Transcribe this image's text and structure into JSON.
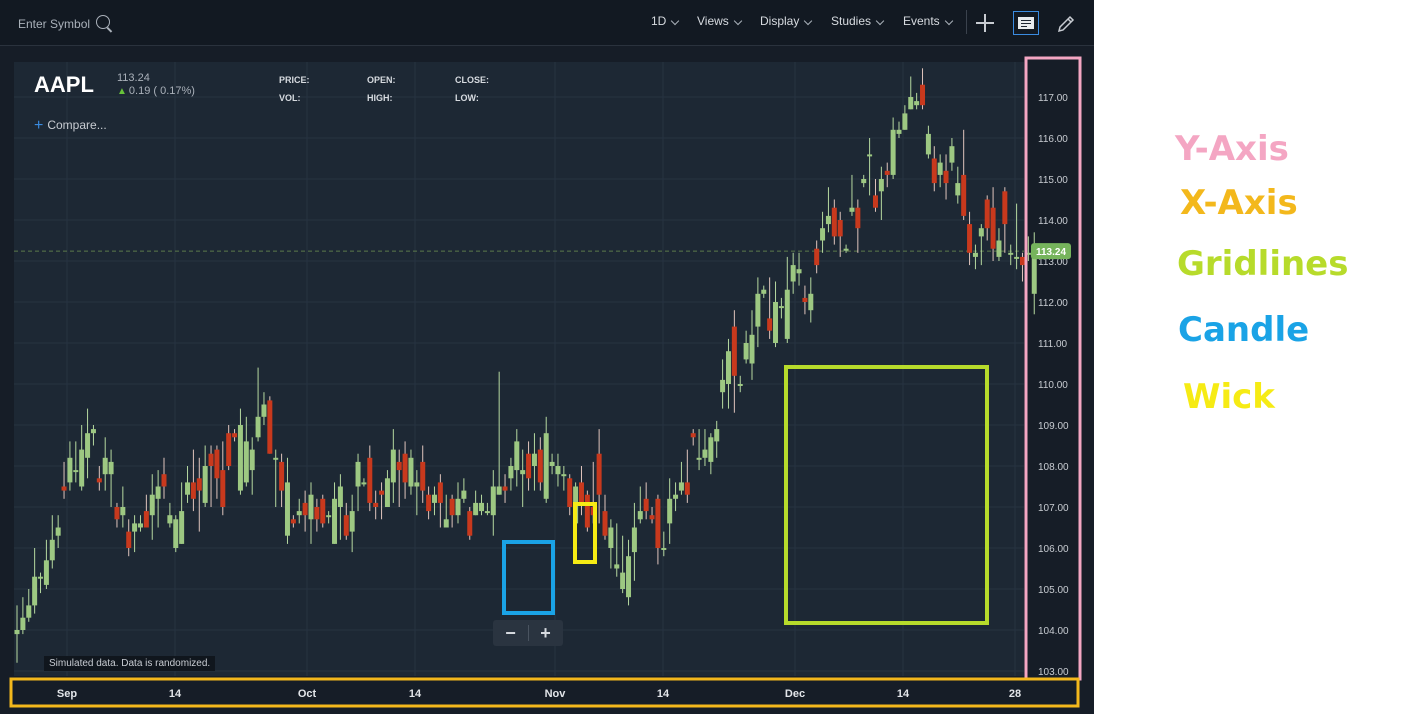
{
  "toolbar": {
    "search_placeholder": "Enter Symbol",
    "interval": "1D",
    "menus": [
      "Views",
      "Display",
      "Studies",
      "Events"
    ]
  },
  "quote": {
    "symbol": "AAPL",
    "price": "113.24",
    "change": "0.19 ( 0.17%)",
    "change_direction": "up",
    "labels": {
      "price": "PRICE:",
      "vol": "VOL:",
      "open": "OPEN:",
      "high": "HIGH:",
      "close": "CLOSE:",
      "low": "LOW:"
    }
  },
  "compare_label": "Compare...",
  "disclaimer": "Simulated data. Data is randomized.",
  "zoom": {
    "minus": "−",
    "plus": "+"
  },
  "colors": {
    "up": "#9dc882",
    "down": "#c8391d",
    "last_price": "#76b45c",
    "y_axis_box": "#f4a6c3",
    "x_axis_box": "#f3b81c",
    "gridlines_box": "#b7db2b",
    "candle_box": "#1aa3e6",
    "wick_box": "#f6eb14"
  },
  "annotations": [
    {
      "key": "y_axis",
      "label": "Y-Axis",
      "color": "#f4a6c3"
    },
    {
      "key": "x_axis",
      "label": "X-Axis",
      "color": "#f3b81c"
    },
    {
      "key": "gridlines",
      "label": "Gridlines",
      "color": "#b7db2b"
    },
    {
      "key": "candle",
      "label": "Candle",
      "color": "#1aa3e6"
    },
    {
      "key": "wick",
      "label": "Wick",
      "color": "#f6eb14"
    }
  ],
  "chart_data": {
    "type": "candlestick",
    "symbol": "AAPL",
    "y_tick_labels": [
      "103.00",
      "104.00",
      "105.00",
      "106.00",
      "107.00",
      "108.00",
      "109.00",
      "110.00",
      "111.00",
      "112.00",
      "113.00",
      "114.00",
      "115.00",
      "116.00",
      "117.00"
    ],
    "x_tick_labels": [
      "Sep",
      "14",
      "Oct",
      "14",
      "Nov",
      "14",
      "Dec",
      "14",
      "28"
    ],
    "ylim": [
      103.0,
      117.65
    ],
    "last_price": 113.24,
    "last_price_label": "113.24",
    "grid": true,
    "candles": [
      [
        103.9,
        104.0,
        104.6,
        103.2
      ],
      [
        104.0,
        104.3,
        104.8,
        103.9
      ],
      [
        104.3,
        104.6,
        105.0,
        104.2
      ],
      [
        104.6,
        105.3,
        106.0,
        104.4
      ],
      [
        105.3,
        105.3,
        105.4,
        104.9
      ],
      [
        105.1,
        105.7,
        106.2,
        105.0
      ],
      [
        105.7,
        106.2,
        106.8,
        105.5
      ],
      [
        106.3,
        106.5,
        106.8,
        106.0
      ],
      [
        107.5,
        107.4,
        108.1,
        107.2
      ],
      [
        107.6,
        108.2,
        108.6,
        107.4
      ],
      [
        107.9,
        107.9,
        108.6,
        107.6
      ],
      [
        107.5,
        108.4,
        109.0,
        107.4
      ],
      [
        108.2,
        108.8,
        109.4,
        107.7
      ],
      [
        108.8,
        108.9,
        109.0,
        108.5
      ],
      [
        107.7,
        107.6,
        108.0,
        107.4
      ],
      [
        107.8,
        108.2,
        108.7,
        107.4
      ],
      [
        107.8,
        108.1,
        108.4,
        107.0
      ],
      [
        107.0,
        106.7,
        107.1,
        106.5
      ],
      [
        106.8,
        107.0,
        107.5,
        106.5
      ],
      [
        106.4,
        106.0,
        106.7,
        105.8
      ],
      [
        106.4,
        106.6,
        106.8,
        105.9
      ],
      [
        106.5,
        106.6,
        106.8,
        106.4
      ],
      [
        106.9,
        106.5,
        107.3,
        106.5
      ],
      [
        106.8,
        107.3,
        107.8,
        106.2
      ],
      [
        107.2,
        107.5,
        107.9,
        106.5
      ],
      [
        107.8,
        107.5,
        108.2,
        107.2
      ],
      [
        106.6,
        106.8,
        107.1,
        106.5
      ],
      [
        106.0,
        106.7,
        106.8,
        105.9
      ],
      [
        106.1,
        106.9,
        107.6,
        106.1
      ],
      [
        107.3,
        107.6,
        108.0,
        107.1
      ],
      [
        107.6,
        107.2,
        108.4,
        106.9
      ],
      [
        107.7,
        107.4,
        108.2,
        106.4
      ],
      [
        107.1,
        108.0,
        108.5,
        107.0
      ],
      [
        108.3,
        108.0,
        108.5,
        107.0
      ],
      [
        108.4,
        107.7,
        108.5,
        107.2
      ],
      [
        107.9,
        107.0,
        108.6,
        106.8
      ],
      [
        108.8,
        108.0,
        109.0,
        107.9
      ],
      [
        108.8,
        108.7,
        108.9,
        108.6
      ],
      [
        107.4,
        109.0,
        109.4,
        107.3
      ],
      [
        107.6,
        108.6,
        109.2,
        107.5
      ],
      [
        107.9,
        108.4,
        108.7,
        107.3
      ],
      [
        108.7,
        109.2,
        110.4,
        108.6
      ],
      [
        109.2,
        109.5,
        109.8,
        109.0
      ],
      [
        109.6,
        108.3,
        109.7,
        108.3
      ],
      [
        108.2,
        108.2,
        108.4,
        107.0
      ],
      [
        108.1,
        107.4,
        108.3,
        107.0
      ],
      [
        106.3,
        107.6,
        108.2,
        106.1
      ],
      [
        106.7,
        106.6,
        106.8,
        106.5
      ],
      [
        106.8,
        106.9,
        107.2,
        106.6
      ],
      [
        107.1,
        106.8,
        107.4,
        106.4
      ],
      [
        106.7,
        107.3,
        107.6,
        106.1
      ],
      [
        107.0,
        106.7,
        107.2,
        106.4
      ],
      [
        107.2,
        106.6,
        107.3,
        106.5
      ],
      [
        106.8,
        106.8,
        106.9,
        106.6
      ],
      [
        106.1,
        107.2,
        107.6,
        106.1
      ],
      [
        107.0,
        107.5,
        107.8,
        106.2
      ],
      [
        106.8,
        106.3,
        107.1,
        106.2
      ],
      [
        106.4,
        106.9,
        107.3,
        105.9
      ],
      [
        107.5,
        108.1,
        108.3,
        106.9
      ],
      [
        107.6,
        107.6,
        107.7,
        107.5
      ],
      [
        108.2,
        107.1,
        108.5,
        106.9
      ],
      [
        107.1,
        107.0,
        107.4,
        106.7
      ],
      [
        107.4,
        107.3,
        107.6,
        106.7
      ],
      [
        107.0,
        107.7,
        107.9,
        107.0
      ],
      [
        107.6,
        108.4,
        108.9,
        107.1
      ],
      [
        108.1,
        107.9,
        108.4,
        107.0
      ],
      [
        108.3,
        107.6,
        108.6,
        107.2
      ],
      [
        107.5,
        108.2,
        108.4,
        107.3
      ],
      [
        107.5,
        107.6,
        107.9,
        106.8
      ],
      [
        108.1,
        107.4,
        108.5,
        107.1
      ],
      [
        107.3,
        106.9,
        107.5,
        106.7
      ],
      [
        107.1,
        107.3,
        107.5,
        106.8
      ],
      [
        107.6,
        107.1,
        107.8,
        106.5
      ],
      [
        106.5,
        106.7,
        107.3,
        106.5
      ],
      [
        107.2,
        106.8,
        107.3,
        106.5
      ],
      [
        106.8,
        107.2,
        107.6,
        106.6
      ],
      [
        107.2,
        107.4,
        107.7,
        107.1
      ],
      [
        106.9,
        106.3,
        107.0,
        106.2
      ],
      [
        106.8,
        107.1,
        107.4,
        106.8
      ],
      [
        106.9,
        107.1,
        107.3,
        106.8
      ],
      [
        106.9,
        106.9,
        107.1,
        106.8
      ],
      [
        106.8,
        107.5,
        107.9,
        106.3
      ],
      [
        107.3,
        107.5,
        110.3,
        107.3
      ],
      [
        107.5,
        107.4,
        107.8,
        107.1
      ],
      [
        107.7,
        108.0,
        108.2,
        107.4
      ],
      [
        107.9,
        108.6,
        108.9,
        107.5
      ],
      [
        107.8,
        107.9,
        108.4,
        107.0
      ],
      [
        108.3,
        107.7,
        108.6,
        107.4
      ],
      [
        108.0,
        108.3,
        108.8,
        107.4
      ],
      [
        108.4,
        107.6,
        108.7,
        107.4
      ],
      [
        107.2,
        108.8,
        109.2,
        107.1
      ],
      [
        108.0,
        108.1,
        108.3,
        107.8
      ],
      [
        107.8,
        108.0,
        108.3,
        107.5
      ],
      [
        107.8,
        107.8,
        108.0,
        107.4
      ],
      [
        107.7,
        107.0,
        107.8,
        106.8
      ],
      [
        106.6,
        107.5,
        107.6,
        106.5
      ],
      [
        107.6,
        107.1,
        108.0,
        106.8
      ],
      [
        107.3,
        106.5,
        107.4,
        106.4
      ],
      [
        107.0,
        106.8,
        108.1,
        106.6
      ],
      [
        108.3,
        107.3,
        108.9,
        106.6
      ],
      [
        106.9,
        106.3,
        107.3,
        106.2
      ],
      [
        106.0,
        106.5,
        106.7,
        105.5
      ],
      [
        105.5,
        105.6,
        106.6,
        105.3
      ],
      [
        105.0,
        105.4,
        106.3,
        104.9
      ],
      [
        104.8,
        105.8,
        106.2,
        104.6
      ],
      [
        105.9,
        106.5,
        107.1,
        105.2
      ],
      [
        106.7,
        106.9,
        107.5,
        106.6
      ],
      [
        107.2,
        106.9,
        107.6,
        106.7
      ],
      [
        106.8,
        106.7,
        107.0,
        106.6
      ],
      [
        107.2,
        106.0,
        107.3,
        105.6
      ],
      [
        106.0,
        106.0,
        106.4,
        105.8
      ],
      [
        106.6,
        107.2,
        107.7,
        106.1
      ],
      [
        107.2,
        107.3,
        107.6,
        106.9
      ],
      [
        107.4,
        107.6,
        108.1,
        107.3
      ],
      [
        107.6,
        107.3,
        108.4,
        107.1
      ],
      [
        108.8,
        108.7,
        108.9,
        108.5
      ],
      [
        108.2,
        108.2,
        108.9,
        107.9
      ],
      [
        108.2,
        108.4,
        108.9,
        108.0
      ],
      [
        108.1,
        108.7,
        108.8,
        107.8
      ],
      [
        108.6,
        108.9,
        109.1,
        108.2
      ],
      [
        109.8,
        110.1,
        110.6,
        109.4
      ],
      [
        110.0,
        110.8,
        111.1,
        109.4
      ],
      [
        111.4,
        110.2,
        111.8,
        109.3
      ],
      [
        110.0,
        110.0,
        110.2,
        109.8
      ],
      [
        110.6,
        111.0,
        111.3,
        110.5
      ],
      [
        110.5,
        111.2,
        111.8,
        110.1
      ],
      [
        111.4,
        112.2,
        112.6,
        110.9
      ],
      [
        112.2,
        112.3,
        112.4,
        112.1
      ],
      [
        111.6,
        111.3,
        112.6,
        111.1
      ],
      [
        111.0,
        112.0,
        112.5,
        110.9
      ],
      [
        111.9,
        111.9,
        112.1,
        111.6
      ],
      [
        111.1,
        112.3,
        113.1,
        111.0
      ],
      [
        112.5,
        112.9,
        113.2,
        112.2
      ],
      [
        112.7,
        112.8,
        113.2,
        112.4
      ],
      [
        112.1,
        112.0,
        112.4,
        111.7
      ],
      [
        111.8,
        112.2,
        112.6,
        111.5
      ],
      [
        113.3,
        112.9,
        113.5,
        112.7
      ],
      [
        113.5,
        113.8,
        114.2,
        113.2
      ],
      [
        113.9,
        114.1,
        114.8,
        113.7
      ],
      [
        114.3,
        113.6,
        114.5,
        113.4
      ],
      [
        114.0,
        113.6,
        114.2,
        113.1
      ],
      [
        113.3,
        113.3,
        113.4,
        113.2
      ],
      [
        114.2,
        114.3,
        115.1,
        114.1
      ],
      [
        114.3,
        113.8,
        114.5,
        113.2
      ],
      [
        114.9,
        115.0,
        115.1,
        114.8
      ],
      [
        115.6,
        115.6,
        116.0,
        114.6
      ],
      [
        114.6,
        114.3,
        115.0,
        114.2
      ],
      [
        114.7,
        115.0,
        115.3,
        114.0
      ],
      [
        115.2,
        115.1,
        115.4,
        114.8
      ],
      [
        115.1,
        116.2,
        116.5,
        115.0
      ],
      [
        116.1,
        116.2,
        116.4,
        116.0
      ],
      [
        116.2,
        116.6,
        116.8,
        116.2
      ],
      [
        116.7,
        117.0,
        117.5,
        116.7
      ],
      [
        116.8,
        116.9,
        117.1,
        116.7
      ],
      [
        117.3,
        116.8,
        117.7,
        116.7
      ],
      [
        115.6,
        116.1,
        116.3,
        115.5
      ],
      [
        115.5,
        114.9,
        115.8,
        114.7
      ],
      [
        115.1,
        115.4,
        115.6,
        114.8
      ],
      [
        115.2,
        114.9,
        115.6,
        114.5
      ],
      [
        115.4,
        115.8,
        116.0,
        115.2
      ],
      [
        114.6,
        114.9,
        115.3,
        114.4
      ],
      [
        115.1,
        114.1,
        116.2,
        114.0
      ],
      [
        113.9,
        113.2,
        114.2,
        112.9
      ],
      [
        113.1,
        113.2,
        113.4,
        112.8
      ],
      [
        113.6,
        113.8,
        113.9,
        112.9
      ],
      [
        114.5,
        113.8,
        114.6,
        113.5
      ],
      [
        114.3,
        113.3,
        114.8,
        113.0
      ],
      [
        113.1,
        113.5,
        113.8,
        113.0
      ],
      [
        114.7,
        113.9,
        114.8,
        113.2
      ],
      [
        113.2,
        113.2,
        113.4,
        112.9
      ],
      [
        113.1,
        113.1,
        114.4,
        112.8
      ],
      [
        113.1,
        112.9,
        113.2,
        112.5
      ],
      [
        113.2,
        113.2,
        113.6,
        113.0
      ],
      [
        112.2,
        113.3,
        113.7,
        111.7
      ]
    ]
  }
}
